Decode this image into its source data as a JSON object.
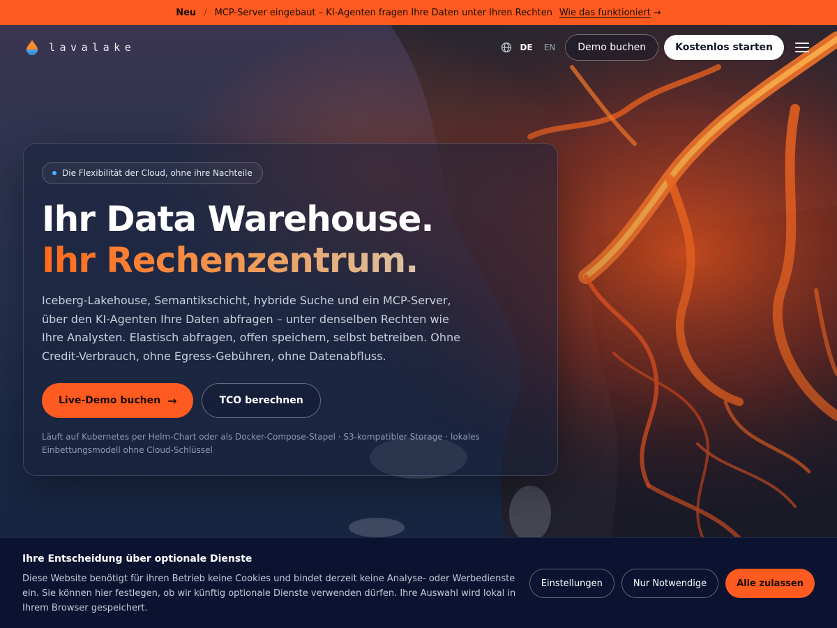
{
  "announcement": {
    "badge": "Neu",
    "separator": "/",
    "text": "MCP-Server eingebaut – KI-Agenten fragen Ihre Daten unter Ihren Rechten",
    "link": "Wie das funktioniert",
    "link_arrow": "→"
  },
  "header": {
    "logo_text": "lavalake",
    "languages": [
      "DE",
      "EN"
    ],
    "active_language": "DE",
    "demo_label": "Demo buchen",
    "start_label": "Kostenlos starten"
  },
  "hero": {
    "pill_text": "Die Flexibilität der Cloud, ohne ihre Nachteile",
    "headline_line1": "Ihr Data Warehouse.",
    "headline_line2": "Ihr Rechenzentrum.",
    "lead": "Iceberg-Lakehouse, Semantikschicht, hybride Suche und ein MCP-Server, über den KI-Agenten Ihre Daten abfragen – unter denselben Rechten wie Ihre Analysten. Elastisch abfragen, offen speichern, selbst betreiben. Ohne Credit-Verbrauch, ohne Egress-Gebühren, ohne Datenabfluss.",
    "cta_primary": "Live-Demo buchen",
    "cta_primary_arrow": "→",
    "cta_secondary": "TCO berechnen",
    "footnote": "Läuft auf Kubernetes per Helm-Chart oder als Docker-Compose-Stapel · S3-kompatibler Storage · lokales Einbettungsmodell ohne Cloud-Schlüssel"
  },
  "cookie_banner": {
    "title": "Ihre Entscheidung über optionale Dienste",
    "text": "Diese Website benötigt für ihren Betrieb keine Cookies und bindet derzeit keine Analyse- oder Werbedienste ein. Sie können hier festlegen, ob wir künftig optionale Dienste verwenden dürfen. Ihre Auswahl wird lokal in Ihrem Browser gespeichert.",
    "settings_label": "Einstellungen",
    "necessary_label": "Nur Notwendige",
    "accept_label": "Alle zulassen"
  },
  "colors": {
    "accent": "#ff5a1f",
    "info_dot": "#3fb6ff",
    "banner_bg": "#0b1330"
  },
  "icons": {
    "logo": "lava-drop-icon",
    "language": "globe-icon",
    "menu": "hamburger-menu-icon",
    "arrow": "arrow-right-icon"
  }
}
